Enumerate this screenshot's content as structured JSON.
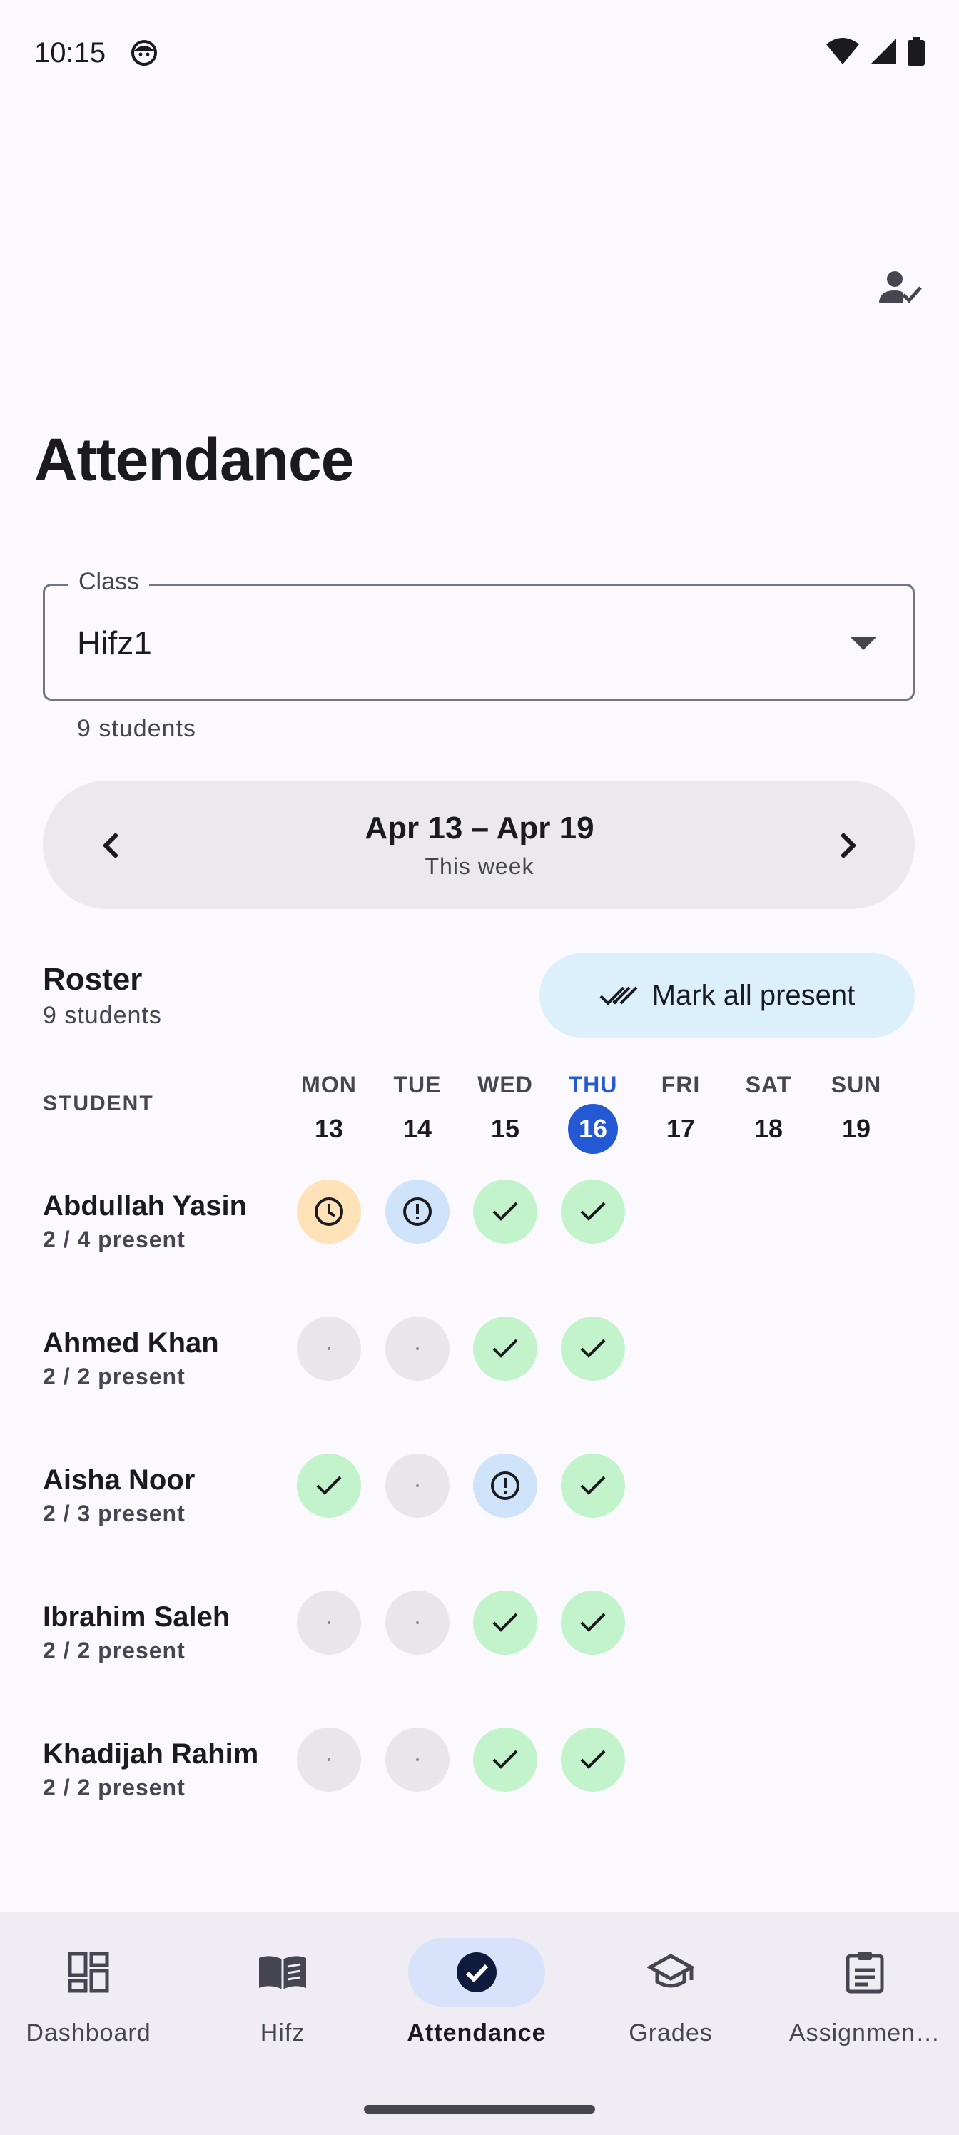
{
  "status_bar": {
    "time": "10:15"
  },
  "page": {
    "title": "Attendance"
  },
  "class_field": {
    "label": "Class",
    "value": "Hifz1",
    "support": "9 students"
  },
  "week": {
    "range": "Apr 13 – Apr 19",
    "subtitle": "This week"
  },
  "roster": {
    "title": "Roster",
    "count": "9 students",
    "mark_all_label": "Mark all present",
    "student_header": "STUDENT",
    "days": [
      {
        "name": "MON",
        "num": "13",
        "active": false
      },
      {
        "name": "TUE",
        "num": "14",
        "active": false
      },
      {
        "name": "WED",
        "num": "15",
        "active": false
      },
      {
        "name": "THU",
        "num": "16",
        "active": true
      },
      {
        "name": "FRI",
        "num": "17",
        "active": false
      },
      {
        "name": "SAT",
        "num": "18",
        "active": false
      },
      {
        "name": "SUN",
        "num": "19",
        "active": false
      }
    ],
    "students": [
      {
        "name": "Abdullah Yasin",
        "summary": "2 / 4 present",
        "marks": [
          "late",
          "excused",
          "present",
          "present"
        ]
      },
      {
        "name": "Ahmed Khan",
        "summary": "2 / 2 present",
        "marks": [
          "none",
          "none",
          "present",
          "present"
        ]
      },
      {
        "name": "Aisha Noor",
        "summary": "2 / 3 present",
        "marks": [
          "present",
          "none",
          "excused",
          "present"
        ]
      },
      {
        "name": "Ibrahim Saleh",
        "summary": "2 / 2 present",
        "marks": [
          "none",
          "none",
          "present",
          "present"
        ]
      },
      {
        "name": "Khadijah Rahim",
        "summary": "2 / 2 present",
        "marks": [
          "none",
          "none",
          "present",
          "present"
        ]
      }
    ]
  },
  "bottom_nav": [
    {
      "label": "Dashboard",
      "icon": "dashboard-icon",
      "active": false
    },
    {
      "label": "Hifz",
      "icon": "book-icon",
      "active": false
    },
    {
      "label": "Attendance",
      "icon": "check-circle-icon",
      "active": true
    },
    {
      "label": "Grades",
      "icon": "school-icon",
      "active": false
    },
    {
      "label": "Assignmen…",
      "icon": "clipboard-icon",
      "active": false
    }
  ],
  "colors": {
    "accent": "#2459d6",
    "present": "#c2f3cb",
    "late": "#ffe2b8",
    "excused": "#cfe4fb",
    "none": "#e8e6eb"
  }
}
